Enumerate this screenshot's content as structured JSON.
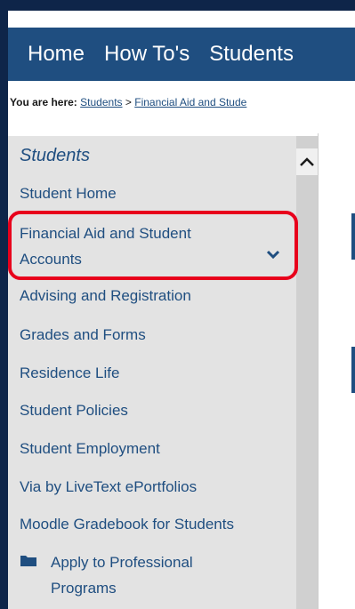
{
  "nav": {
    "items": [
      "Home",
      "How To's",
      "Students"
    ]
  },
  "breadcrumb": {
    "label": "You are here:",
    "links": [
      "Students",
      "Financial Aid and Stude"
    ],
    "separator": ">"
  },
  "sidebar": {
    "title": "Students",
    "items": [
      "Student Home",
      "Financial Aid and Student",
      "Accounts",
      "Advising and Registration",
      "Grades and Forms",
      "Residence Life",
      "Student Policies",
      "Student Employment",
      "Via by LiveText ePortfolios",
      "Moodle Gradebook for Students",
      "Apply to Professional",
      "Programs"
    ]
  },
  "colors": {
    "nav_bg": "#1f4e80",
    "link": "#1f4e80",
    "highlight": "#e8001c",
    "frame": "#0e2549"
  }
}
